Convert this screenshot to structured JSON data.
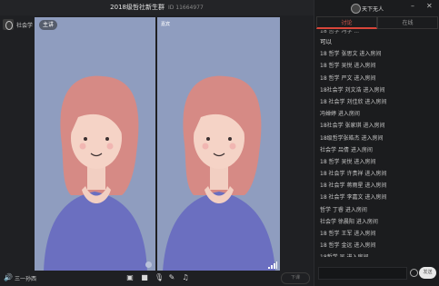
{
  "title": {
    "name": "2018级哲社新生群",
    "room_id": "ID 11664977"
  },
  "host": {
    "name": "社会学"
  },
  "panes": {
    "left_badge": "主讲",
    "right_label": "嘉宾"
  },
  "toolbar": {
    "mic_status": "三一孙西",
    "end_label": "下课"
  },
  "panel": {
    "user": "天下无人",
    "tabs": [
      {
        "label": "讨论"
      },
      {
        "label": "在线"
      }
    ],
    "messages": [
      {
        "text": "18 哲学 冯学 ...",
        "style": "cut"
      },
      {
        "text": "可以",
        "style": "big"
      },
      {
        "text": "18 哲学 张思文 进入房间",
        "style": ""
      },
      {
        "text": "18 哲学 吴悦 进入房间",
        "style": ""
      },
      {
        "text": "18 哲学 严文 进入房间",
        "style": ""
      },
      {
        "text": "18社会学 刘文浩 进入房间",
        "style": ""
      },
      {
        "text": "18 社会学 刘佳欣 进入房间",
        "style": ""
      },
      {
        "text": "冯婵婷 进入房间",
        "style": ""
      },
      {
        "text": "18社会学 张家琪 进入房间",
        "style": ""
      },
      {
        "text": "18级哲学张皓杰 进入房间",
        "style": ""
      },
      {
        "text": "社会学 吕倩 进入房间",
        "style": ""
      },
      {
        "text": "18 哲学 吴悦 进入房间",
        "style": ""
      },
      {
        "text": "18 社会学 许贵祥 进入房间",
        "style": ""
      },
      {
        "text": "18 社会学 蒋雨星 进入房间",
        "style": ""
      },
      {
        "text": "18 社会学 李嘉文 进入房间",
        "style": ""
      },
      {
        "text": "哲学 丁睿 进入房间",
        "style": ""
      },
      {
        "text": "社会学 徐晨阳 进入房间",
        "style": ""
      },
      {
        "text": "18 哲学 王军 进入房间",
        "style": ""
      },
      {
        "text": "18 哲学 金远 进入房间",
        "style": ""
      },
      {
        "text": "18哲学 吴 进入房间",
        "style": ""
      },
      {
        "text": "关注主播",
        "style": "red"
      }
    ],
    "input_placeholder": "",
    "send_label": "发送"
  },
  "colors": {
    "pane_bg": "#8f9dbf",
    "accent": "#d9463a"
  }
}
